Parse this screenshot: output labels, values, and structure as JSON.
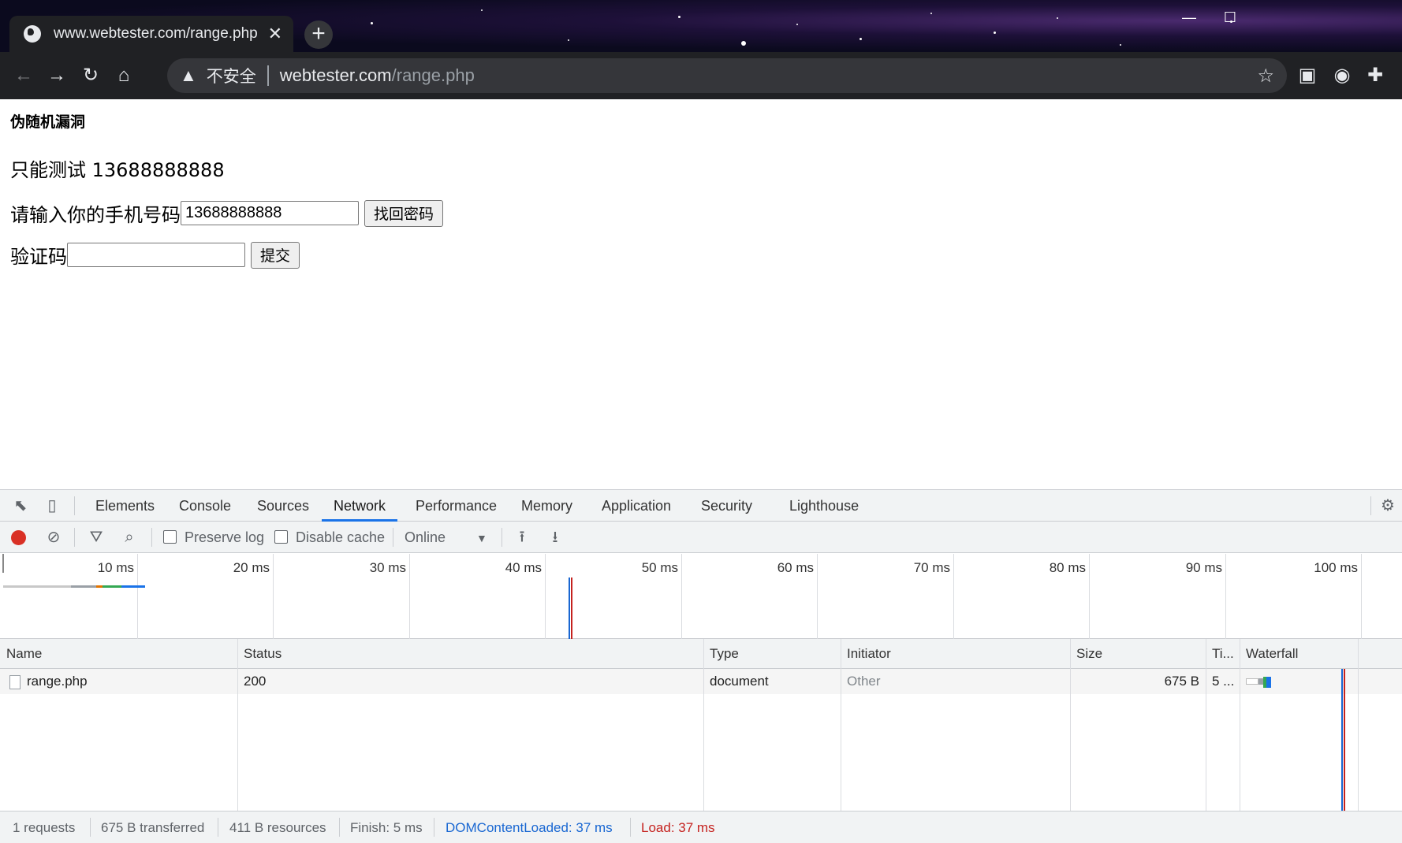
{
  "browser": {
    "tab_title": "www.webtester.com/range.php",
    "tab_close": "✕",
    "new_tab": "+",
    "address": {
      "security_label": "不安全",
      "host": "webtester.com",
      "path": "/range.php"
    }
  },
  "page": {
    "heading": "伪随机漏洞",
    "note": "只能测试 13688888888",
    "phone_label": "请输入你的手机号码",
    "phone_value": "13688888888",
    "recover_button": "找回密码",
    "code_label": "验证码",
    "code_value": "",
    "submit_button": "提交"
  },
  "devtools": {
    "tabs": [
      "Elements",
      "Console",
      "Sources",
      "Network",
      "Performance",
      "Memory",
      "Application",
      "Security",
      "Lighthouse"
    ],
    "active_tab": "Network",
    "toolbar": {
      "preserve_log": "Preserve log",
      "disable_cache": "Disable cache",
      "throttle": "Online"
    },
    "timeline_ticks": [
      "10 ms",
      "20 ms",
      "30 ms",
      "40 ms",
      "50 ms",
      "60 ms",
      "70 ms",
      "80 ms",
      "90 ms",
      "100 ms"
    ],
    "columns": [
      "Name",
      "Status",
      "Type",
      "Initiator",
      "Size",
      "Ti...",
      "Waterfall"
    ],
    "rows": [
      {
        "name": "range.php",
        "status": "200",
        "type": "document",
        "initiator": "Other",
        "size": "675 B",
        "time": "5 ..."
      }
    ],
    "summary": {
      "requests": "1 requests",
      "transferred": "675 B transferred",
      "resources": "411 B resources",
      "finish": "Finish: 5 ms",
      "dcl": "DOMContentLoaded: 37 ms",
      "load": "Load: 37 ms"
    },
    "colors": {
      "accent": "#1a73e8",
      "dcl": "#1967d2",
      "load": "#c5221f",
      "record": "#d93025"
    }
  }
}
